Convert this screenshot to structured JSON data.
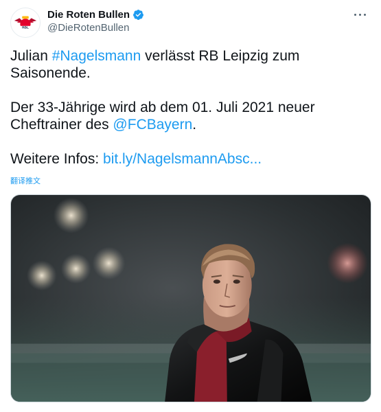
{
  "tweet": {
    "author": {
      "display_name": "Die Roten Bullen",
      "handle": "@DieRotenBullen",
      "verified": true,
      "avatar_icon": "rb-leipzig-logo"
    },
    "text": {
      "line1_prefix": "Julian ",
      "hashtag": "#Nagelsmann",
      "line1_suffix": " verlässt RB Leipzig zum Saisonende.",
      "line2_prefix": "Der 33-Jährige wird ab dem 01. Juli 2021 neuer Cheftrainer des ",
      "mention": "@FCBayern",
      "line2_suffix": ".",
      "line3_prefix": "Weitere Infos: ",
      "url": "bit.ly/NagelsmannAbsc..."
    },
    "translate_label": "翻译推文",
    "media": {
      "type": "photo",
      "icon": "photo-image"
    },
    "menu_icon": "more-options-icon"
  },
  "colors": {
    "link": "#1d9bf0",
    "text": "#0f1419",
    "secondary": "#536471",
    "verified": "#1d9bf0"
  }
}
